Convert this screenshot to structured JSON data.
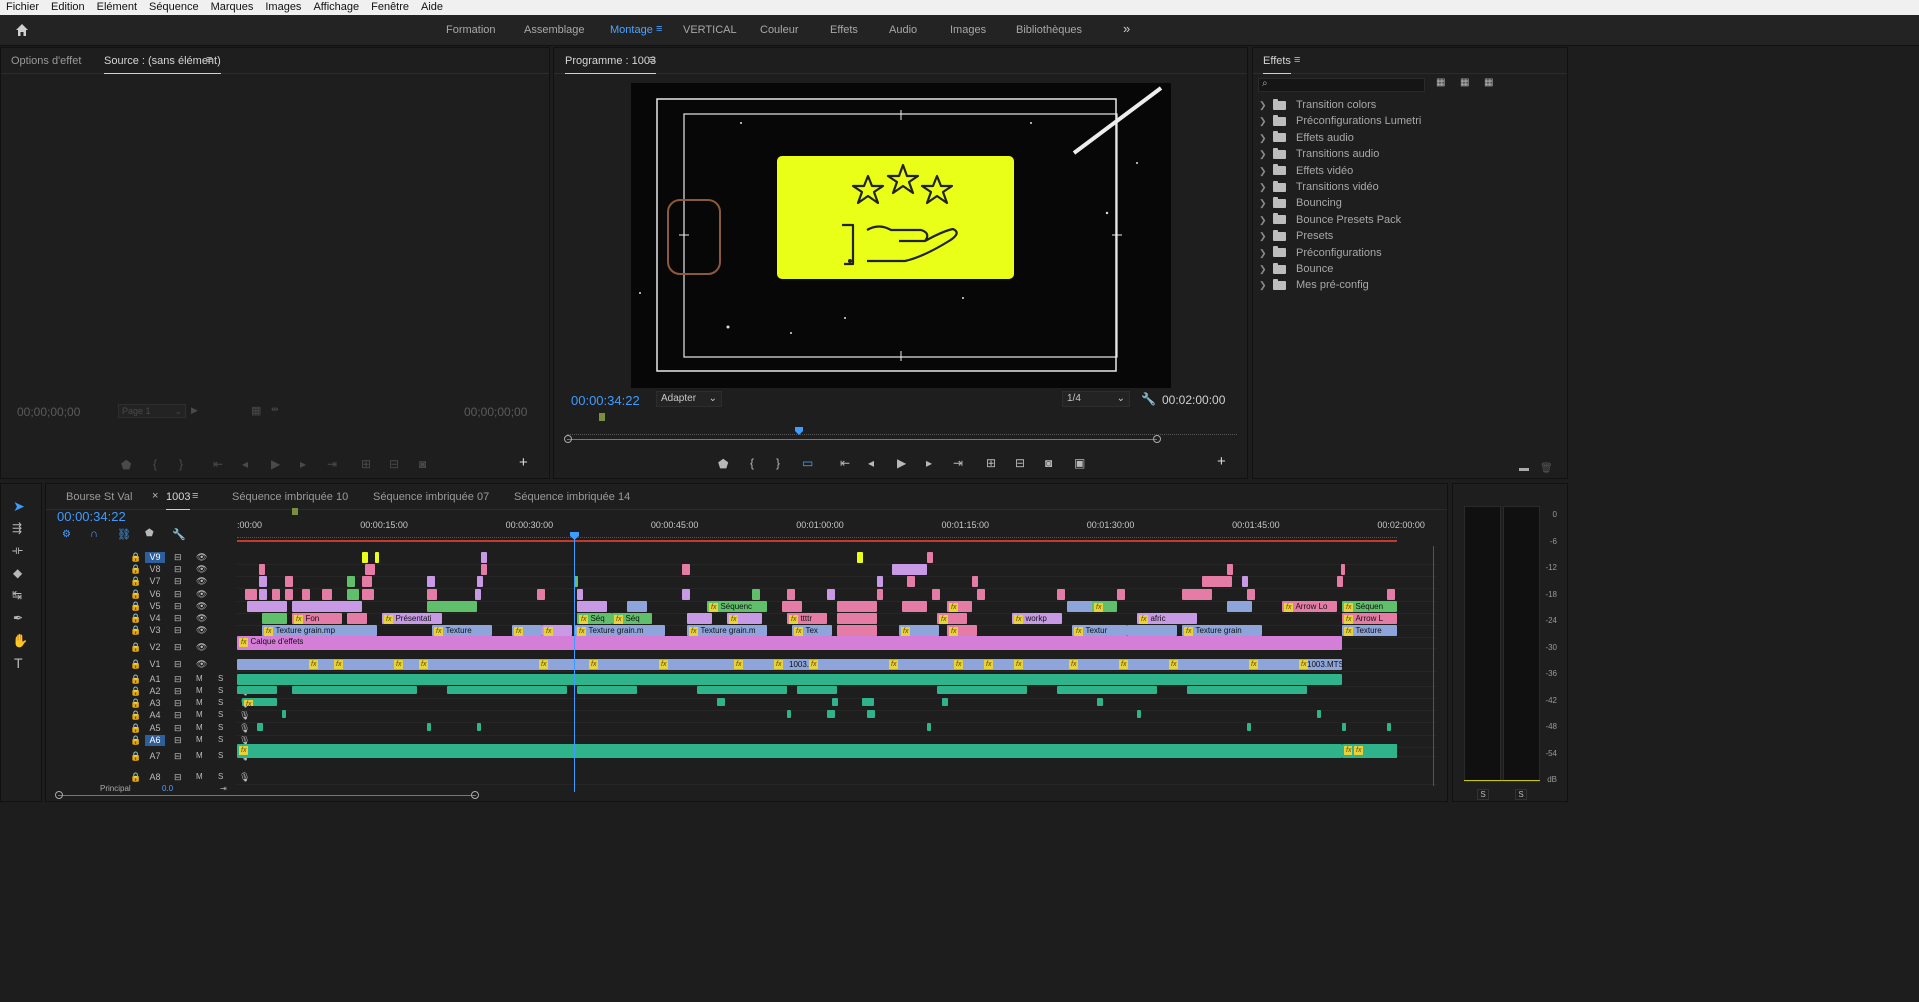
{
  "menu": [
    "Fichier",
    "Edition",
    "Elément",
    "Séquence",
    "Marques",
    "Images",
    "Affichage",
    "Fenêtre",
    "Aide"
  ],
  "workspaces": [
    {
      "label": "Formation",
      "active": false
    },
    {
      "label": "Assemblage",
      "active": false
    },
    {
      "label": "Montage",
      "active": true
    },
    {
      "label": "VERTICAL",
      "active": false
    },
    {
      "label": "Couleur",
      "active": false
    },
    {
      "label": "Effets",
      "active": false
    },
    {
      "label": "Audio",
      "active": false
    },
    {
      "label": "Images",
      "active": false
    },
    {
      "label": "Bibliothèques",
      "active": false
    }
  ],
  "source_panel": {
    "tab_effect_options": "Options d'effet",
    "tab_source": "Source : (sans élément)",
    "timecode_left": "00;00;00;00",
    "page": "Page 1",
    "timecode_right": "00;00;00;00"
  },
  "program_panel": {
    "title": "Programme : 1003",
    "timecode": "00:00:34:22",
    "fit": "Adapter",
    "resolution": "1/4",
    "duration": "00:02:00:00"
  },
  "effects_panel": {
    "title": "Effets",
    "search_placeholder": "",
    "items": [
      "Transition colors",
      "Préconfigurations Lumetri",
      "Effets audio",
      "Transitions audio",
      "Effets vidéo",
      "Transitions vidéo",
      "Bouncing",
      "Bounce Presets Pack",
      "Presets",
      "Préconfigurations",
      "Bounce",
      "Mes pré-config"
    ]
  },
  "timeline": {
    "tabs": [
      "Bourse St Val",
      "1003",
      "Séquence imbriquée 10",
      "Séquence imbriquée 07",
      "Séquence imbriquée 14"
    ],
    "active_tab": "1003",
    "timecode": "00:00:34:22",
    "ruler": [
      ":00:00",
      "00:00:15:00",
      "00:00:30:00",
      "00:00:45:00",
      "00:01:00:00",
      "00:01:15:00",
      "00:01:30:00",
      "00:01:45:00",
      "00:02:00:00"
    ],
    "video_tracks": [
      "V9",
      "V8",
      "V7",
      "V6",
      "V5",
      "V4",
      "V3",
      "V2",
      "V1"
    ],
    "audio_tracks": [
      "A1",
      "A2",
      "A3",
      "A4",
      "A5",
      "A6",
      "A7",
      "A8"
    ],
    "selected_tracks": [
      "V9",
      "A6"
    ],
    "mix_label": "Principal",
    "mix_value": "0.0",
    "clip_labels": {
      "adjustment": "Calque d'effets",
      "v1_a": "1003.",
      "v1_b": "1003.MTS",
      "v3_a": "Texture grain.mp",
      "v3_b": "Texture",
      "v3_c": "Texture grain.m",
      "v3_d": "Texture grain.m",
      "v3_e": "Tex",
      "v3_f": "Textur",
      "v3_g": "Texture grain",
      "v3_h": "Texture",
      "v4_a": "Fon",
      "v4_b": "Présentati",
      "v4_c": "Séq",
      "v4_d": "ttttr",
      "v4_e": "workp",
      "v4_f": "afric",
      "v4_g": "Arrow L",
      "v5_a": "Séquenc",
      "v5_b": "Arro",
      "v5_c": "Arrow Lo",
      "v5_d": "Séquen",
      "a7_a": "Pul"
    }
  },
  "meter": {
    "scale": [
      "0",
      "-6",
      "-12",
      "-18",
      "-24",
      "-30",
      "-36",
      "-42",
      "-48",
      "-54",
      "dB"
    ],
    "solo_buttons": [
      "S",
      "S"
    ]
  },
  "colors": {
    "accent": "#3e9bff",
    "playhead": "#3e9bff",
    "clip_pink": "#e57ca6",
    "clip_violet": "#c89ae6",
    "clip_blue": "#8ea5db",
    "clip_green": "#5fbf6b",
    "audio_green": "#2fb38b",
    "adjustment": "#d57ed8",
    "graphic_yellow": "#eaff17"
  }
}
